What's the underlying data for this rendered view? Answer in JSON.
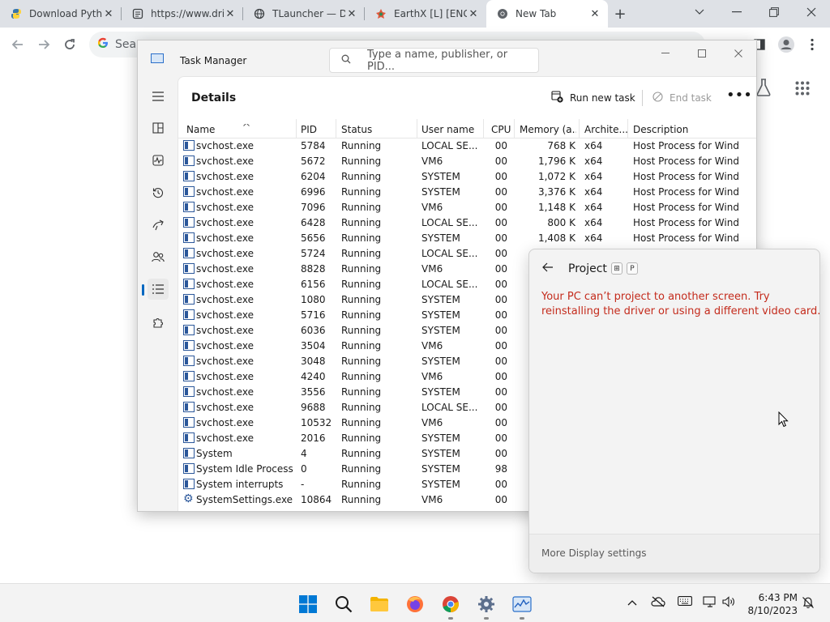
{
  "browser": {
    "tabs": [
      {
        "title": "Download Pyth",
        "icon": "python-icon"
      },
      {
        "title": "https://www.dri",
        "icon": "page-icon"
      },
      {
        "title": "TLauncher — D",
        "icon": "globe-icon"
      },
      {
        "title": "EarthX [L] [ENG",
        "icon": "earthx-icon"
      },
      {
        "title": "New Tab",
        "icon": "chrome-icon"
      }
    ],
    "omnibox_text": "Searc",
    "new_tab_symbol": "+",
    "tab_close_symbol": "✕"
  },
  "task_manager": {
    "title": "Task Manager",
    "search_placeholder": "Type a name, publisher, or PID...",
    "section_title": "Details",
    "run_new_task": "Run new task",
    "end_task": "End task",
    "more_symbol": "•••",
    "columns": [
      "Name",
      "PID",
      "Status",
      "User name",
      "CPU",
      "Memory (a...",
      "Archite...",
      "Description"
    ],
    "rows": [
      {
        "name": "svchost.exe",
        "pid": "5784",
        "status": "Running",
        "user": "LOCAL SE...",
        "cpu": "00",
        "mem": "768 K",
        "arch": "x64",
        "desc": "Host Process for Wind..."
      },
      {
        "name": "svchost.exe",
        "pid": "5672",
        "status": "Running",
        "user": "VM6",
        "cpu": "00",
        "mem": "1,796 K",
        "arch": "x64",
        "desc": "Host Process for Wind..."
      },
      {
        "name": "svchost.exe",
        "pid": "6204",
        "status": "Running",
        "user": "SYSTEM",
        "cpu": "00",
        "mem": "1,072 K",
        "arch": "x64",
        "desc": "Host Process for Wind..."
      },
      {
        "name": "svchost.exe",
        "pid": "6996",
        "status": "Running",
        "user": "SYSTEM",
        "cpu": "00",
        "mem": "3,376 K",
        "arch": "x64",
        "desc": "Host Process for Wind..."
      },
      {
        "name": "svchost.exe",
        "pid": "7096",
        "status": "Running",
        "user": "VM6",
        "cpu": "00",
        "mem": "1,148 K",
        "arch": "x64",
        "desc": "Host Process for Wind..."
      },
      {
        "name": "svchost.exe",
        "pid": "6428",
        "status": "Running",
        "user": "LOCAL SE...",
        "cpu": "00",
        "mem": "800 K",
        "arch": "x64",
        "desc": "Host Process for Wind..."
      },
      {
        "name": "svchost.exe",
        "pid": "5656",
        "status": "Running",
        "user": "SYSTEM",
        "cpu": "00",
        "mem": "1,408 K",
        "arch": "x64",
        "desc": "Host Process for Wind..."
      },
      {
        "name": "svchost.exe",
        "pid": "5724",
        "status": "Running",
        "user": "LOCAL SE...",
        "cpu": "00",
        "mem": "",
        "arch": "",
        "desc": ""
      },
      {
        "name": "svchost.exe",
        "pid": "8828",
        "status": "Running",
        "user": "VM6",
        "cpu": "00",
        "mem": "",
        "arch": "",
        "desc": ""
      },
      {
        "name": "svchost.exe",
        "pid": "6156",
        "status": "Running",
        "user": "LOCAL SE...",
        "cpu": "00",
        "mem": "",
        "arch": "",
        "desc": ""
      },
      {
        "name": "svchost.exe",
        "pid": "1080",
        "status": "Running",
        "user": "SYSTEM",
        "cpu": "00",
        "mem": "",
        "arch": "",
        "desc": ""
      },
      {
        "name": "svchost.exe",
        "pid": "5716",
        "status": "Running",
        "user": "SYSTEM",
        "cpu": "00",
        "mem": "",
        "arch": "",
        "desc": ""
      },
      {
        "name": "svchost.exe",
        "pid": "6036",
        "status": "Running",
        "user": "SYSTEM",
        "cpu": "00",
        "mem": "",
        "arch": "",
        "desc": ""
      },
      {
        "name": "svchost.exe",
        "pid": "3504",
        "status": "Running",
        "user": "VM6",
        "cpu": "00",
        "mem": "",
        "arch": "",
        "desc": ""
      },
      {
        "name": "svchost.exe",
        "pid": "3048",
        "status": "Running",
        "user": "SYSTEM",
        "cpu": "00",
        "mem": "",
        "arch": "",
        "desc": ""
      },
      {
        "name": "svchost.exe",
        "pid": "4240",
        "status": "Running",
        "user": "VM6",
        "cpu": "00",
        "mem": "",
        "arch": "",
        "desc": ""
      },
      {
        "name": "svchost.exe",
        "pid": "3556",
        "status": "Running",
        "user": "SYSTEM",
        "cpu": "00",
        "mem": "",
        "arch": "",
        "desc": ""
      },
      {
        "name": "svchost.exe",
        "pid": "9688",
        "status": "Running",
        "user": "LOCAL SE...",
        "cpu": "00",
        "mem": "",
        "arch": "",
        "desc": ""
      },
      {
        "name": "svchost.exe",
        "pid": "10532",
        "status": "Running",
        "user": "VM6",
        "cpu": "00",
        "mem": "",
        "arch": "",
        "desc": ""
      },
      {
        "name": "svchost.exe",
        "pid": "2016",
        "status": "Running",
        "user": "SYSTEM",
        "cpu": "00",
        "mem": "",
        "arch": "",
        "desc": ""
      },
      {
        "name": "System",
        "pid": "4",
        "status": "Running",
        "user": "SYSTEM",
        "cpu": "00",
        "mem": "",
        "arch": "",
        "desc": ""
      },
      {
        "name": "System Idle Process",
        "pid": "0",
        "status": "Running",
        "user": "SYSTEM",
        "cpu": "98",
        "mem": "",
        "arch": "",
        "desc": ""
      },
      {
        "name": "System interrupts",
        "pid": "-",
        "status": "Running",
        "user": "SYSTEM",
        "cpu": "00",
        "mem": "",
        "arch": "",
        "desc": ""
      },
      {
        "name": "SystemSettings.exe",
        "pid": "10864",
        "status": "Running",
        "user": "VM6",
        "cpu": "00",
        "mem": "",
        "arch": "",
        "desc": "",
        "gear": true
      }
    ]
  },
  "project_flyout": {
    "title": "Project",
    "key1": "⊞",
    "key2": "P",
    "message": "Your PC can’t project to another screen. Try reinstalling the driver or using a different video card.",
    "footer_link": "More Display settings"
  },
  "taskbar": {
    "time": "6:43 PM",
    "date": "8/10/2023"
  },
  "colors": {
    "accent": "#0067c0",
    "error": "#c42b1c"
  }
}
